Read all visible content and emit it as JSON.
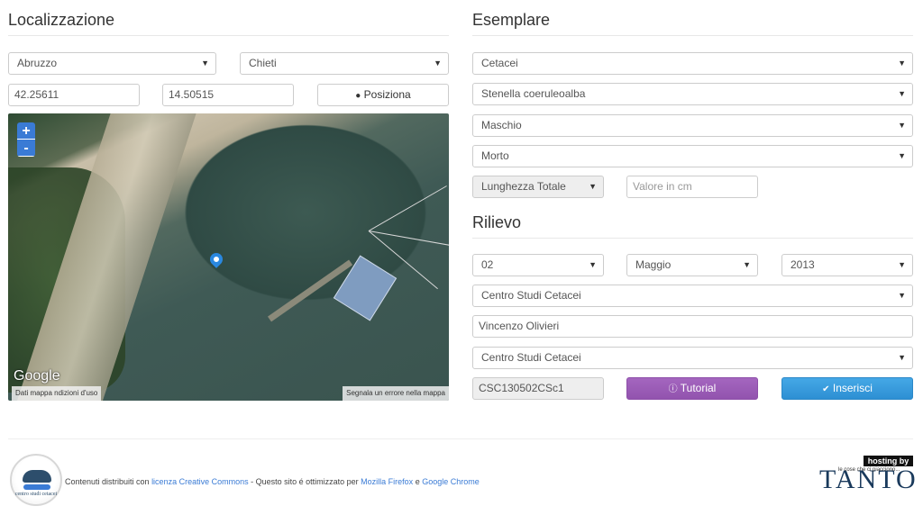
{
  "localizzazione": {
    "title": "Localizzazione",
    "regione": "Abruzzo",
    "provincia": "Chieti",
    "latitudine": "42.25611",
    "longitudine": "14.50515",
    "posiziona_label": "Posiziona",
    "map": {
      "google_logo": "Google",
      "dati_mappa": "Dati mappa",
      "termini": "ndizioni d'uso",
      "segnala": "Segnala un errore nella mappa",
      "zoom_in": "+",
      "zoom_out": "-"
    }
  },
  "esemplare": {
    "title": "Esemplare",
    "famiglia": "Cetacei",
    "specie": "Stenella coeruleoalba",
    "sesso": "Maschio",
    "stato": "Morto",
    "misura": "Lunghezza Totale",
    "valore_placeholder": "Valore in cm"
  },
  "rilievo": {
    "title": "Rilievo",
    "giorno": "02",
    "mese": "Maggio",
    "anno": "2013",
    "ente": "Centro Studi Cetacei",
    "rilevatore": "Vincenzo Olivieri",
    "ente_2": "Centro Studi Cetacei",
    "codice": "CSC130502CSc1",
    "tutorial_label": "Tutorial",
    "inserisci_label": "Inserisci"
  },
  "footer": {
    "text_1": "Contenuti distribuiti con ",
    "link_1": "licenza Creative Commons",
    "text_2": " - Questo sito é ottimizzato per ",
    "link_2": "Mozilla Firefox",
    "text_3": " e ",
    "link_3": "Google Chrome",
    "logo_text": "centro studi cetacei",
    "hosting": "hosting by",
    "tanto_sub": "le cose che ci piacciono...",
    "tanto": "TANTO"
  },
  "colors": {
    "tutorial": "#9b59b6",
    "inserisci": "#3498db",
    "link": "#3a7bd5"
  }
}
